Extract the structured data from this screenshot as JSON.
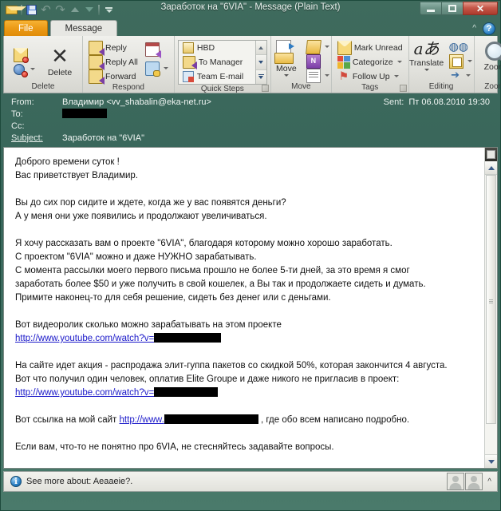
{
  "window": {
    "title": "Заработок на \"6VIA\"  -  Message (Plain Text)",
    "controls": {
      "minimize": "–",
      "maximize": "□",
      "close": "✕"
    }
  },
  "quick_access_toolbar": {
    "items": [
      {
        "name": "outlook-envelope-icon",
        "label": ""
      },
      {
        "name": "save-icon",
        "label": ""
      },
      {
        "name": "undo-icon",
        "label": "↺"
      },
      {
        "name": "redo-icon",
        "label": "↻"
      },
      {
        "name": "previous-item-icon",
        "label": ""
      },
      {
        "name": "next-item-icon",
        "label": ""
      },
      {
        "name": "customize-qat-icon",
        "label": ""
      }
    ]
  },
  "ribbon": {
    "tabs": [
      {
        "id": "file",
        "label": "File",
        "active": false
      },
      {
        "id": "message",
        "label": "Message",
        "active": true
      }
    ],
    "minimize_ribbon": "^",
    "help": "?",
    "groups": [
      {
        "id": "delete",
        "label": "Delete",
        "ignore_label": "",
        "junk_label": "",
        "delete_label": "Delete"
      },
      {
        "id": "respond",
        "label": "Respond",
        "items": [
          {
            "name": "reply-button",
            "label": "Reply"
          },
          {
            "name": "reply-all-button",
            "label": "Reply All"
          },
          {
            "name": "forward-button",
            "label": "Forward"
          }
        ],
        "extra": [
          {
            "name": "meeting-button",
            "label": ""
          },
          {
            "name": "more-respond-button",
            "label": ""
          }
        ]
      },
      {
        "id": "quick-steps",
        "label": "Quick Steps",
        "items": [
          {
            "name": "quick-step-hbd",
            "label": "HBD"
          },
          {
            "name": "quick-step-to-manager",
            "label": "To Manager"
          },
          {
            "name": "quick-step-team-email",
            "label": "Team E-mail"
          }
        ]
      },
      {
        "id": "move",
        "label": "Move",
        "items": [
          {
            "name": "move-button",
            "label": "Move"
          },
          {
            "name": "onenote-button",
            "label": "N"
          },
          {
            "name": "open-folder-button",
            "label": ""
          },
          {
            "name": "rules-button",
            "label": ""
          }
        ]
      },
      {
        "id": "tags",
        "label": "Tags",
        "items": [
          {
            "name": "mark-unread-button",
            "label": "Mark Unread"
          },
          {
            "name": "categorize-button",
            "label": "Categorize"
          },
          {
            "name": "follow-up-button",
            "label": "Follow Up"
          }
        ]
      },
      {
        "id": "editing",
        "label": "Editing",
        "items": [
          {
            "name": "translate-button",
            "label": "Translate"
          },
          {
            "name": "find-button",
            "label": ""
          },
          {
            "name": "related-button",
            "label": ""
          },
          {
            "name": "select-button",
            "label": ""
          }
        ]
      },
      {
        "id": "zoom",
        "label": "Zoom",
        "items": [
          {
            "name": "zoom-button",
            "label": "Zoom"
          }
        ]
      }
    ]
  },
  "message_header": {
    "from_label": "From:",
    "from_value": "Владимир <vv_shabalin@eka-net.ru>",
    "sent_label": "Sent:",
    "sent_value": "Пт 06.08.2010 19:30",
    "to_label": "To:",
    "to_value_redacted": true,
    "cc_label": "Cc:",
    "cc_value": "",
    "subject_label": "Subject:",
    "subject_value": "Заработок на \"6VIA\""
  },
  "body": {
    "paragraphs": [
      {
        "lines": [
          "Доброго времени суток !",
          "Вас приветствует Владимир."
        ]
      },
      {
        "lines": [
          "Вы до сих пор сидите и ждете, когда же у вас появятся деньги?",
          "А у меня они уже появились и продолжают увеличиваться."
        ]
      },
      {
        "lines": [
          "Я хочу рассказать вам о проекте \"6VIA\", благодаря которому можно хорошо заработать.",
          "С проектом \"6VIA\" можно и даже НУЖНО зарабатывать.",
          "С момента рассылки моего первого письма прошло не более 5-ти дней, за это время я смог",
          "заработать более $50 и уже получить в свой кошелек, а Вы так и продолжаете сидеть и думать.",
          "Примите наконец-то для себя решение, сидеть без денег или с деньгами."
        ]
      },
      {
        "lines": [
          "Вот видеоролик сколько можно зарабатывать на этом проекте"
        ],
        "link": "http://www.youtube.com/watch?v=",
        "redact_after_link": true
      },
      {
        "lines": [
          "На сайте идет акция - распродажа элит-гуппа пакетов со скидкой 50%, которая закончится 4 августа.",
          "Вот что получил один человек, оплатив Elite Groupe и даже никого не пригласив в проект:"
        ],
        "link": "http://www.youtube.com/watch?v=",
        "redact_after_link": true
      },
      {
        "inline": {
          "before": "Вот ссылка на мой сайт ",
          "link": "http://www.",
          "redacted": true,
          "after": " , где обо всем написано подробно."
        }
      },
      {
        "lines": [
          "Если вам, что-то не понятно про 6VIA, не стесняйтесь задавайте вопросы."
        ]
      }
    ]
  },
  "status_bar": {
    "info_icon": "i",
    "text": "See more about: Aeaaeie?.",
    "collapse": "^"
  },
  "colors": {
    "window_frame": "#3f6b5d",
    "file_tab": "#eb9a16",
    "link": "#1a18c9",
    "close_button": "#c6584a",
    "redaction": "#000000"
  }
}
